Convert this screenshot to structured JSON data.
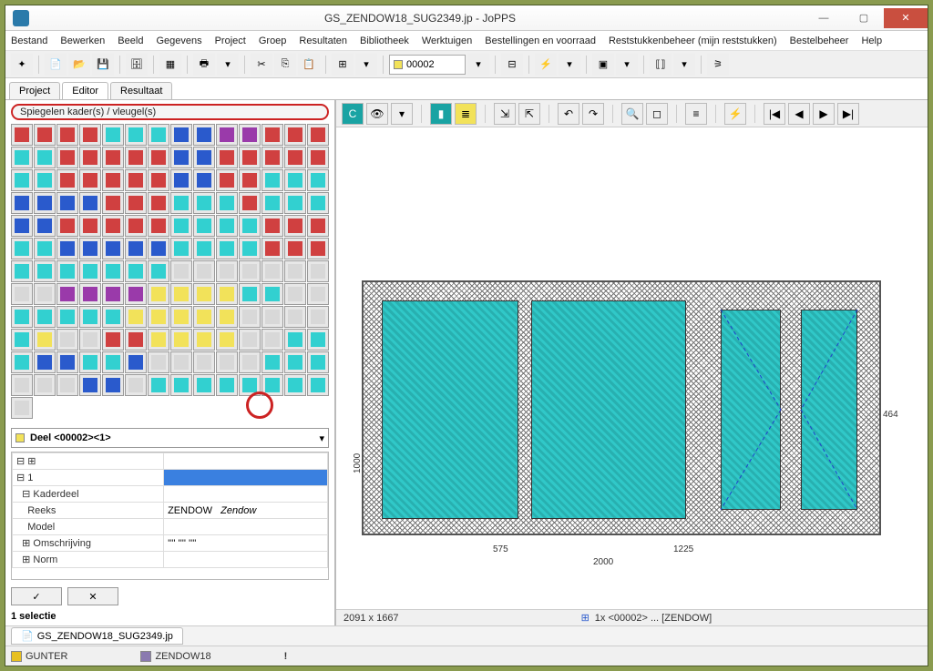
{
  "title": "GS_ZENDOW18_SUG2349.jp - JoPPS",
  "menus": [
    "Bestand",
    "Bewerken",
    "Beeld",
    "Gegevens",
    "Project",
    "Groep",
    "Resultaten",
    "Bibliotheek",
    "Werktuigen",
    "Bestellingen en voorraad",
    "Reststukkenbeheer (mijn reststukken)",
    "Bestelbeheer",
    "Help"
  ],
  "toolbar_combo": "00002",
  "main_tabs": [
    "Project",
    "Editor",
    "Resultaat"
  ],
  "active_main_tab": 1,
  "palette_title": "Spiegelen kader(s) / vleugel(s)",
  "tree_combo": "Deel <00002><1>",
  "props": {
    "r1": "1",
    "r2_k": "Kaderdeel",
    "r3_k": "Reeks",
    "r3_v": "ZENDOW",
    "r3_v2": "Zendow",
    "r4_k": "Model",
    "r5_k": "Omschrijving",
    "r5_v": "'''' '''' ''''",
    "r6_k": "Norm"
  },
  "selection_info": "1 selectie",
  "status": {
    "left": "2091 x 1667",
    "mid_prefix": "1x <00002> ... [ZENDOW]"
  },
  "doc_tab": "GS_ZENDOW18_SUG2349.jp",
  "user": "GUNTER",
  "profile": "ZENDOW18",
  "dims": {
    "width": "2000",
    "left": "575",
    "right": "1225",
    "height": "1000",
    "h2": "464"
  },
  "buttons": {
    "ok": "✓",
    "cancel": "✕"
  },
  "nav": {
    "first": "|◀",
    "prev": "◀",
    "next": "▶",
    "last": "▶|"
  }
}
